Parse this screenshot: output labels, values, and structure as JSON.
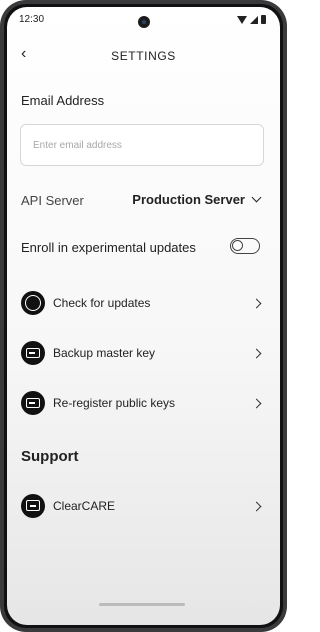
{
  "status_bar": {
    "time": "12:30"
  },
  "header": {
    "title": "SETTINGS"
  },
  "email": {
    "label": "Email Address",
    "placeholder": "Enter email address",
    "value": ""
  },
  "api": {
    "label": "API Server",
    "value": "Production Server"
  },
  "experimental": {
    "label": "Enroll in experimental updates",
    "enabled": false
  },
  "menu": [
    {
      "label": "Check for updates",
      "icon": "refresh-ring-icon"
    },
    {
      "label": "Backup master key",
      "icon": "key-icon"
    },
    {
      "label": "Re-register public keys",
      "icon": "key-icon"
    }
  ],
  "support": {
    "heading": "Support",
    "items": [
      {
        "label": "ClearCARE",
        "icon": "chat-icon"
      }
    ]
  }
}
